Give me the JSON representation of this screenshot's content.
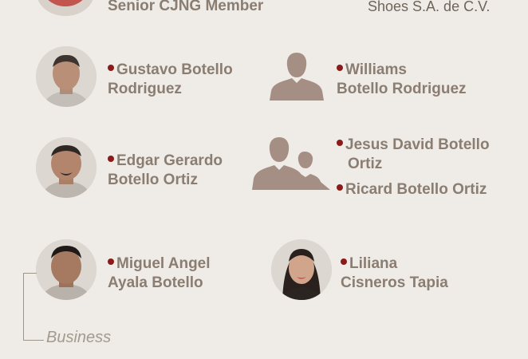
{
  "top": {
    "member_role": "Senior CJNG Member",
    "company": "Shoes S.A. de C.V."
  },
  "people": [
    {
      "line1": "Gustavo Botello",
      "line2": "Rodriguez"
    },
    {
      "line1": "Williams",
      "line2": "Botello Rodriguez"
    },
    {
      "line1": "Edgar Gerardo",
      "line2": "Botello Ortiz"
    },
    {
      "line1": "Jesus David Botello",
      "line2": "Ortiz"
    },
    {
      "line1": "Ricard Botello Ortiz"
    },
    {
      "line1": "Miguel Angel",
      "line2": "Ayala Botello"
    },
    {
      "line1": "Liliana",
      "line2": "Cisneros Tapia"
    }
  ],
  "section_label": "Business",
  "colors": {
    "background": "#efebe6",
    "name_text": "#8a7d72",
    "bullet": "#8b1a1a",
    "silhouette": "#a58f85"
  }
}
